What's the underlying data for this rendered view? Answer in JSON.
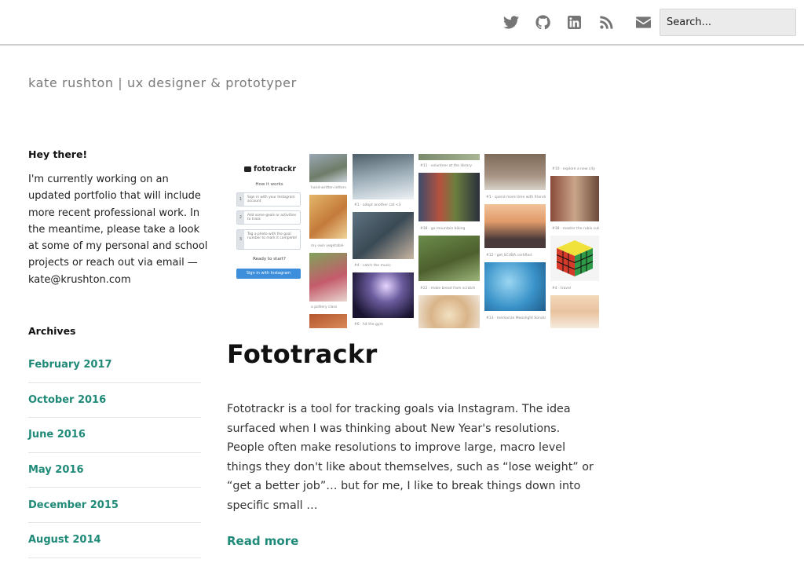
{
  "header": {
    "social_icons": [
      "twitter-icon",
      "github-icon",
      "linkedin-icon",
      "rss-icon",
      "envelope-icon"
    ],
    "search_placeholder": "Search..."
  },
  "site": {
    "title": "kate rushton | ux designer & prototyper"
  },
  "sidebar": {
    "intro_heading": "Hey there!",
    "intro_text": "I'm currently working on an updated portfolio that will include more recent professional work. In the meantime, please take a look at some of my personal and school projects or reach out via email — kate@krushton.com",
    "archives_heading": "Archives",
    "archives": [
      {
        "label": "February 2017"
      },
      {
        "label": "October 2016"
      },
      {
        "label": "June 2016"
      },
      {
        "label": "May 2016"
      },
      {
        "label": "December 2015"
      },
      {
        "label": "August 2014"
      }
    ]
  },
  "post": {
    "feature_image": {
      "logo": "fototrackr",
      "how_it_works": "How it works",
      "steps": [
        {
          "num": "1",
          "text": "Sign in with your Instagram account"
        },
        {
          "num": "2",
          "text": "Add some goals or activities to track"
        },
        {
          "num": "3",
          "text": "Tag a photo with the goal number to mark it complete!"
        }
      ],
      "ready": "Ready to start?",
      "button": "Sign in with Instagram",
      "captions": [
        "hand-written letters",
        "#1 · adopt another cat <3",
        "#11 · volunteer at the library",
        "#1 · spend more time with friends",
        "#10 · explore a new city",
        "my own vegetable",
        "#4 · catch the music",
        "#38 · go mountain biking",
        "#12 · get SCUBA certified",
        "#38 · master the rubix cube",
        "a pottery class",
        "#22 · make bread from scratch",
        "#13 · memorize Moonlight Sonata",
        "#6 · hit the gym",
        "#4 · travel"
      ]
    },
    "title": "Fototrackr",
    "excerpt": "Fototrackr is a tool for tracking goals via Instagram. The idea surfaced when I was thinking about New Year's resolutions. People often make resolutions to improve large, macro level things they don't like about themselves, such as “lose weight” or “get a better job”… but for me, I like to break things down into specific small …",
    "read_more": "Read more"
  },
  "colors": {
    "accent": "#1f8a78",
    "social_icon": "#757575",
    "search_bg": "#ebebeb",
    "site_title": "#7a7a7a"
  }
}
